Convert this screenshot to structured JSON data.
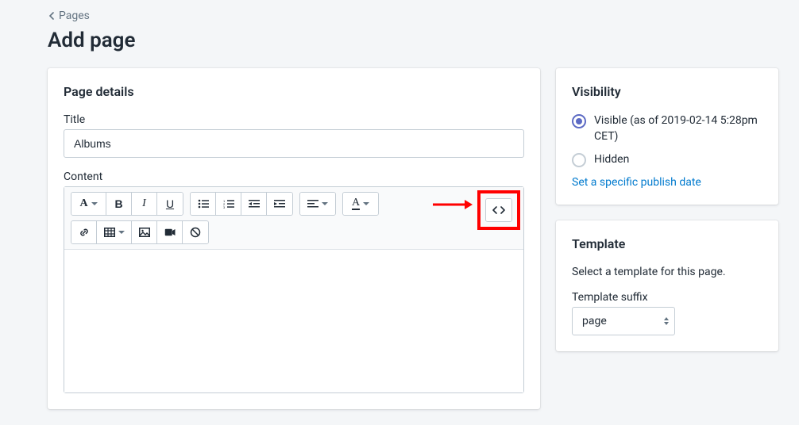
{
  "breadcrumb": {
    "label": "Pages"
  },
  "page_title": "Add page",
  "details": {
    "heading": "Page details",
    "title_label": "Title",
    "title_value": "Albums",
    "content_label": "Content"
  },
  "toolbar": {
    "format_button": "A",
    "bold": "B",
    "italic": "I",
    "underline": "U",
    "color_button": "A"
  },
  "visibility": {
    "heading": "Visibility",
    "visible_label": "Visible (as of 2019-02-14 5:28pm CET)",
    "hidden_label": "Hidden",
    "set_date_link": "Set a specific publish date",
    "selected": "visible"
  },
  "template": {
    "heading": "Template",
    "help": "Select a template for this page.",
    "suffix_label": "Template suffix",
    "suffix_value": "page"
  }
}
